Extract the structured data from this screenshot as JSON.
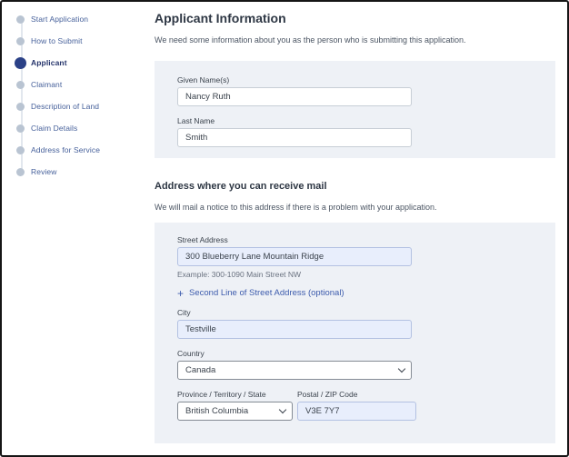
{
  "sidebar": {
    "items": [
      {
        "label": "Start Application",
        "active": false
      },
      {
        "label": "How to Submit",
        "active": false
      },
      {
        "label": "Applicant",
        "active": true
      },
      {
        "label": "Claimant",
        "active": false
      },
      {
        "label": "Description of Land",
        "active": false
      },
      {
        "label": "Claim Details",
        "active": false
      },
      {
        "label": "Address for Service",
        "active": false
      },
      {
        "label": "Review",
        "active": false
      }
    ]
  },
  "main": {
    "title": "Applicant Information",
    "intro": "We need some information about you as the person who is submitting this application.",
    "name_section": {
      "given_name": {
        "label": "Given Name(s)",
        "value": "Nancy Ruth"
      },
      "last_name": {
        "label": "Last Name",
        "value": "Smith"
      }
    },
    "address_section": {
      "heading": "Address where you can receive mail",
      "intro": "We will mail a notice to this address if there is a problem with your application.",
      "street": {
        "label": "Street Address",
        "value": "300 Blueberry Lane Mountain Ridge",
        "hint": "Example: 300-1090 Main Street NW"
      },
      "second_line_link": {
        "plus": "+",
        "label": "Second Line of Street Address (optional)"
      },
      "city": {
        "label": "City",
        "value": "Testville"
      },
      "country": {
        "label": "Country",
        "value": "Canada"
      },
      "province": {
        "label": "Province / Territory / State",
        "value": "British Columbia"
      },
      "postal": {
        "label": "Postal / ZIP Code",
        "value": "V3E 7Y7"
      }
    }
  },
  "colors": {
    "active_step": "#2b4187",
    "inactive_step_dot": "#b9c4d2",
    "sidebar_text": "#47619b",
    "panel_background": "#eef1f6",
    "highlight_input_background": "#e8eefc",
    "link": "#3d5cad"
  }
}
